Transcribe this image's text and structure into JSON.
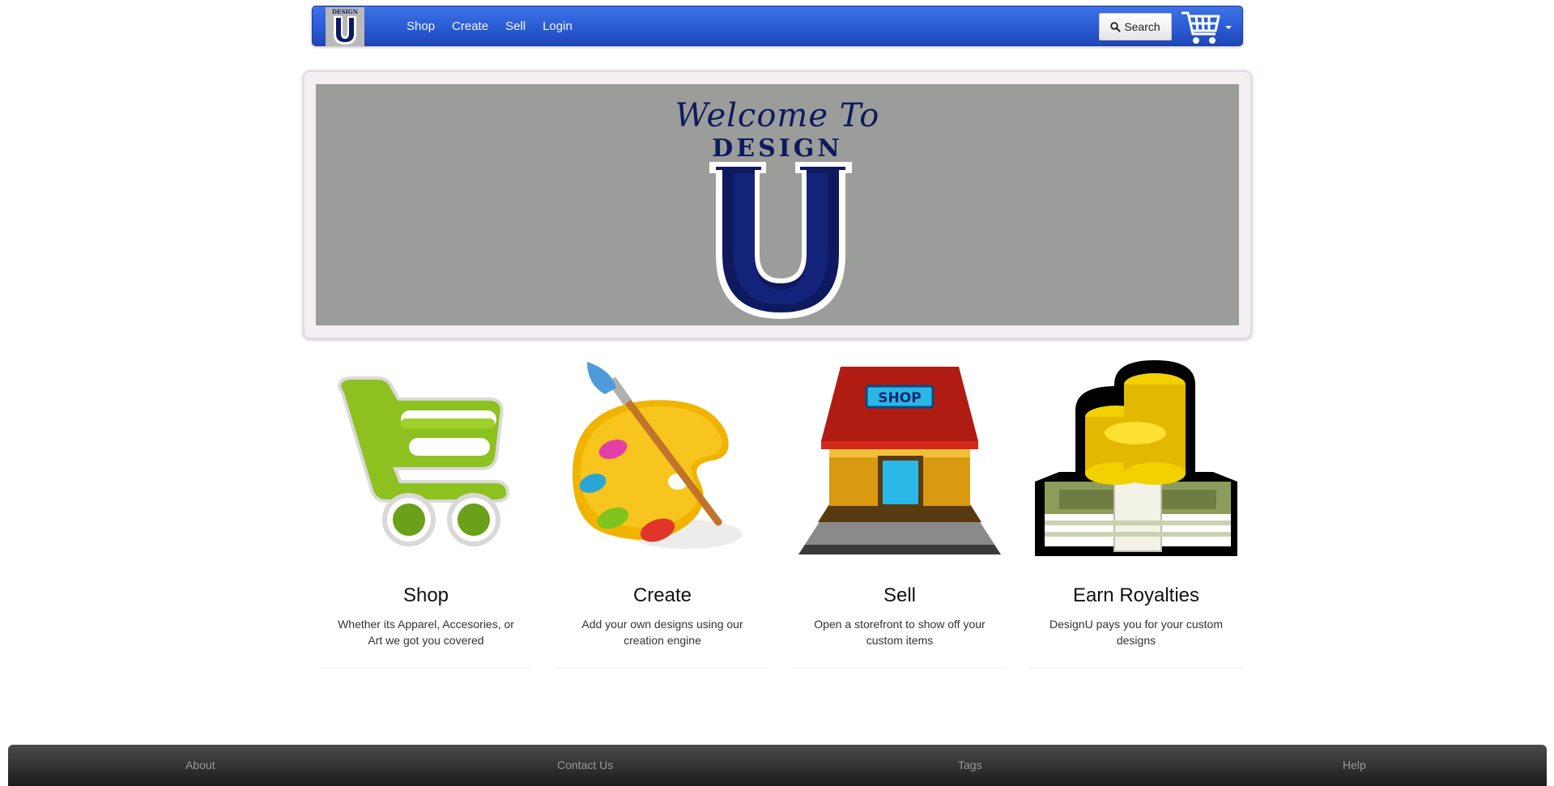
{
  "navbar": {
    "brand_small": "DESIGN",
    "brand_letter": "U",
    "links": [
      "Shop",
      "Create",
      "Sell",
      "Login"
    ],
    "search_label": "Search",
    "search_icon": "magnifier-icon",
    "cart_icon": "shopping-cart-icon",
    "brand_color": "#2d5fd8"
  },
  "hero": {
    "welcome": "Welcome To",
    "design": "DESIGN",
    "letter": "U",
    "text_color": "#0d1a5e",
    "background": "#9b9d9a"
  },
  "features": [
    {
      "title": "Shop",
      "description": "Whether its Apparel, Accesories, or Art we got you covered",
      "icon": "green-cart-icon"
    },
    {
      "title": "Create",
      "description": "Add your own designs using our creation engine",
      "icon": "paint-palette-icon"
    },
    {
      "title": "Sell",
      "description": "Open a storefront to show off your custom items",
      "icon": "storefront-icon",
      "sign": "SHOP"
    },
    {
      "title": "Earn Royalties",
      "description": "DesignU pays you for your custom designs",
      "icon": "money-stack-icon"
    }
  ],
  "footer": {
    "links": [
      "About",
      "Contact Us",
      "Tags",
      "Help"
    ],
    "background": "#2a2a2a"
  }
}
